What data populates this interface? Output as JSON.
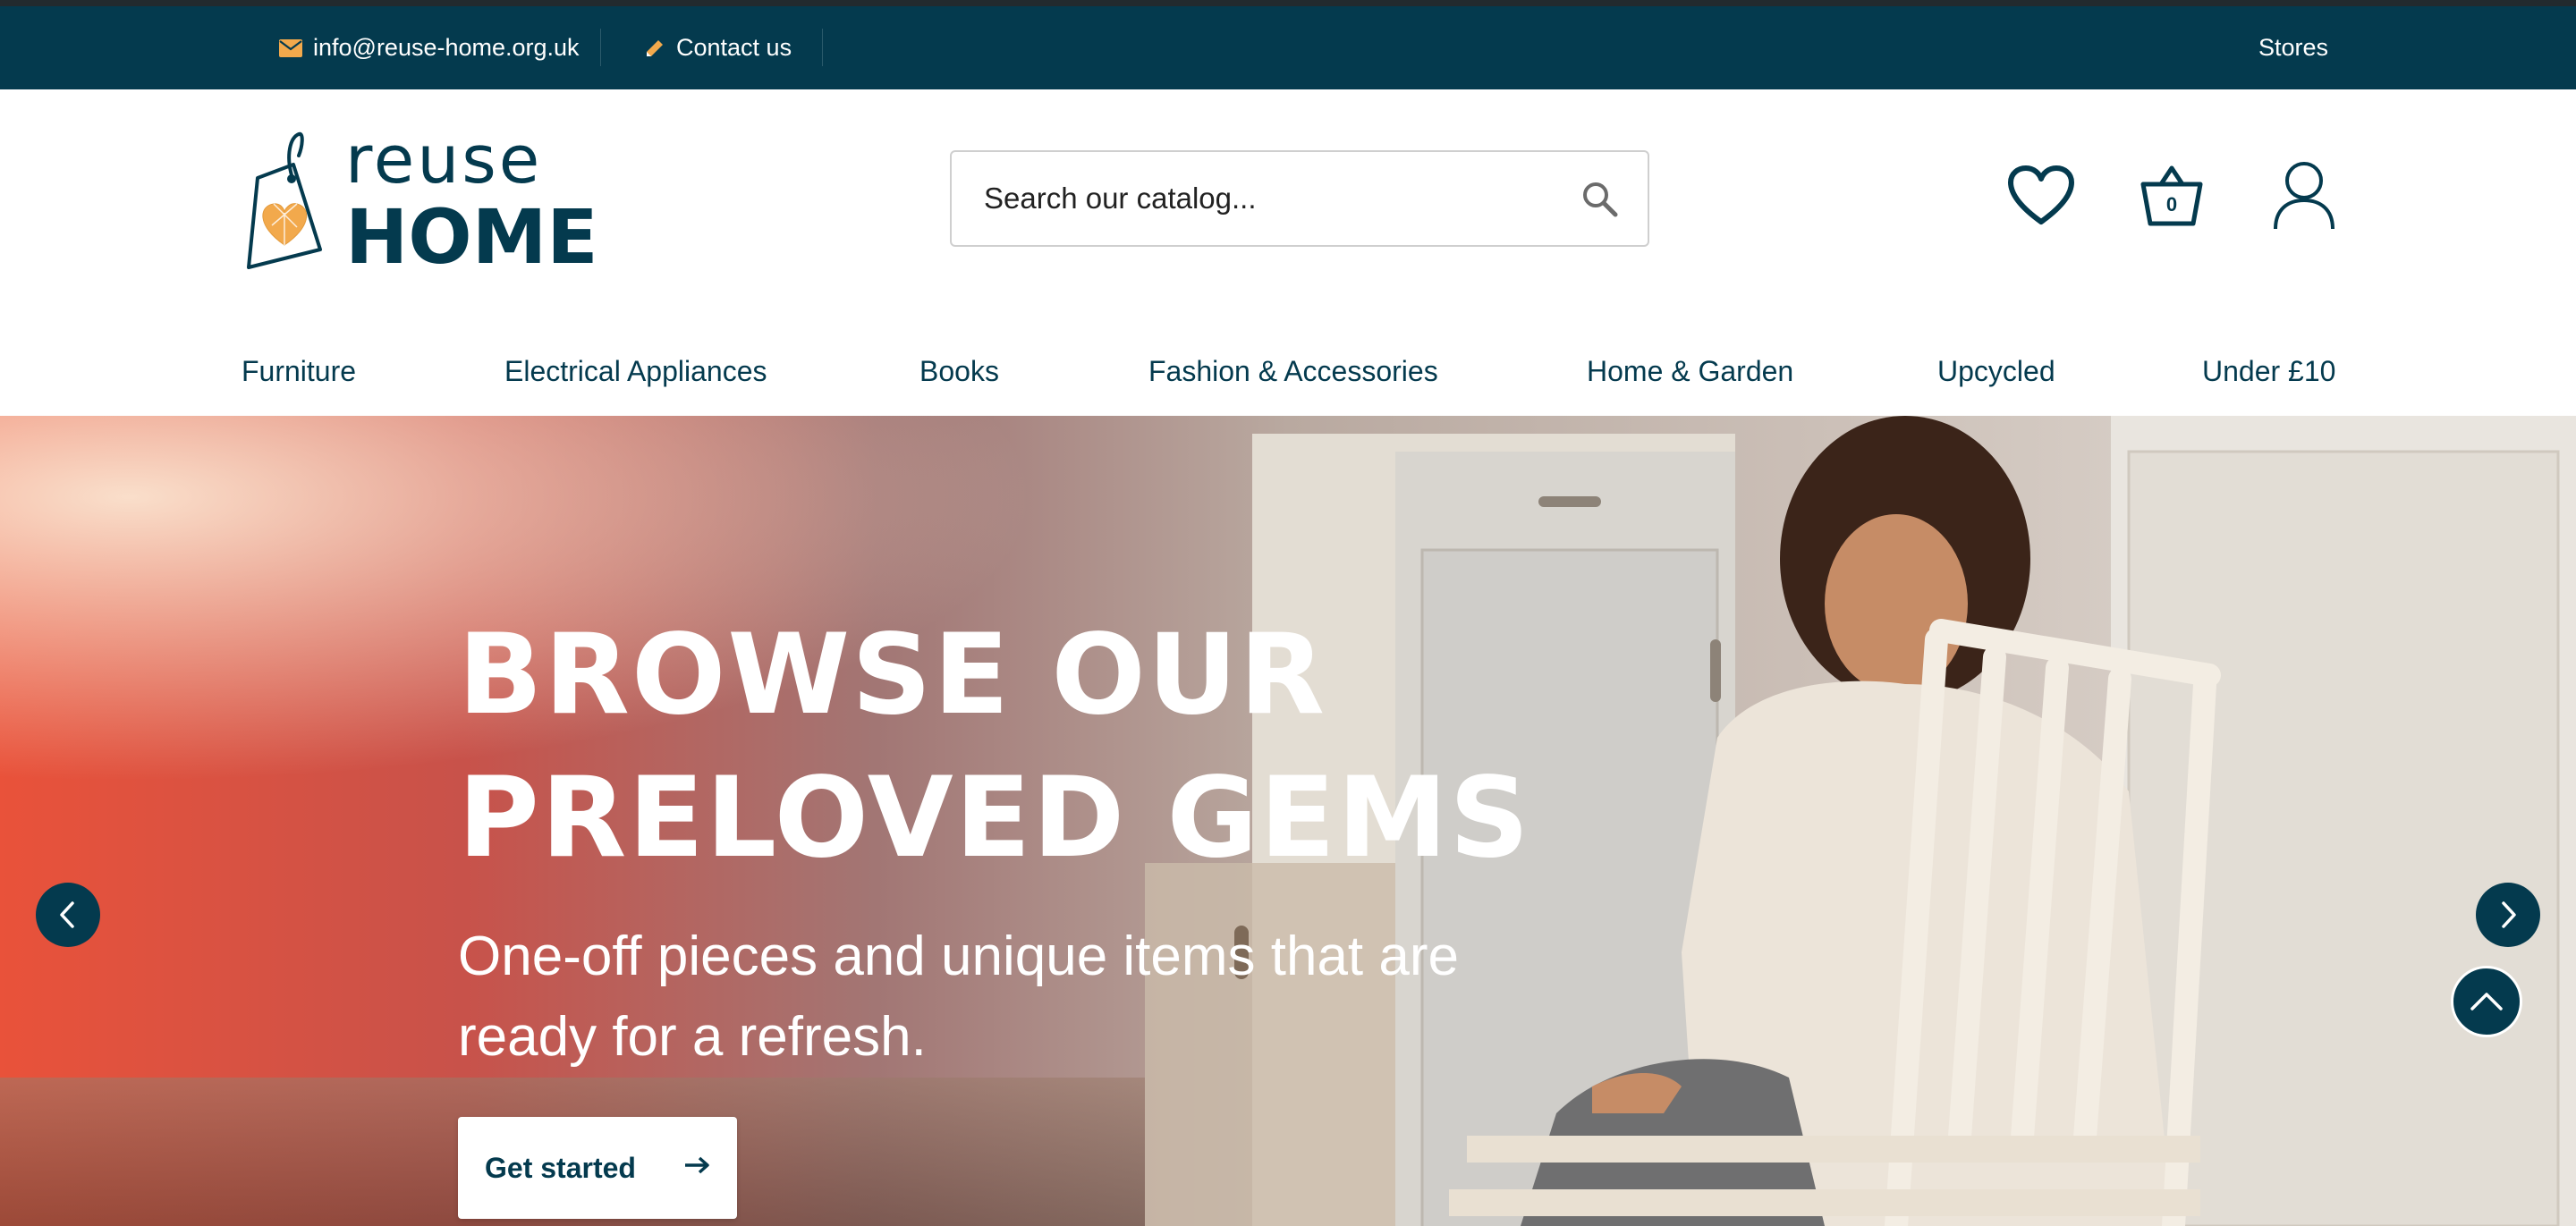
{
  "topbar": {
    "email": "info@reuse-home.org.uk",
    "contact": "Contact us",
    "stores": "Stores"
  },
  "logo": {
    "line1": "reuse",
    "line2": "HOME"
  },
  "search": {
    "placeholder": "Search our catalog..."
  },
  "cart": {
    "count": "0"
  },
  "nav": {
    "items": [
      "Furniture",
      "Electrical Appliances",
      "Books",
      "Fashion & Accessories",
      "Home & Garden",
      "Upcycled",
      "Under £10"
    ]
  },
  "hero": {
    "title_line1": "BROWSE OUR",
    "title_line2": "PRELOVED GEMS",
    "subtitle": "One-off pieces and unique items that are ready for a refresh.",
    "cta_label": "Get started"
  },
  "colors": {
    "brand_dark": "#043a4e",
    "accent_orange": "#f2a94c",
    "white": "#ffffff"
  },
  "icons": {
    "email": "envelope-icon",
    "contact": "pencil-icon",
    "search": "magnifier-icon",
    "wishlist": "heart-icon",
    "cart": "basket-icon",
    "account": "user-icon",
    "prev": "chevron-left-icon",
    "next": "chevron-right-icon",
    "scroll_top": "chevron-up-icon",
    "cta": "arrow-right-icon"
  }
}
